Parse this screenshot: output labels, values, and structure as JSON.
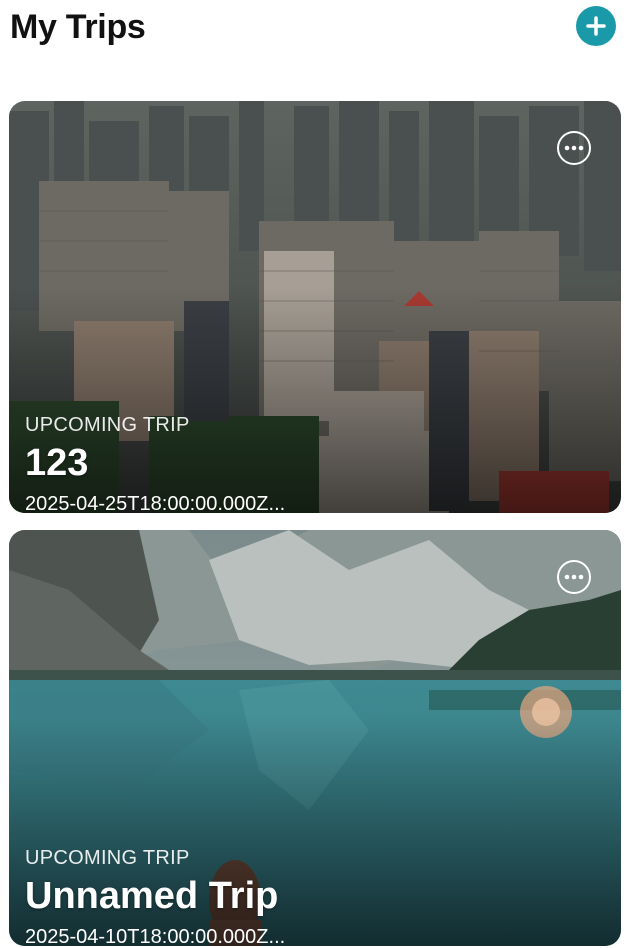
{
  "header": {
    "title": "My Trips",
    "add_icon": "plus-icon"
  },
  "colors": {
    "accent": "#1a9aa8",
    "title": "#111111",
    "card_text": "#ffffff"
  },
  "trips": [
    {
      "status": "UPCOMING TRIP",
      "name": "123",
      "date": "2025-04-25T18:00:00.000Z...",
      "image": "city-skyline",
      "menu_icon": "more-horizontal-icon"
    },
    {
      "status": "UPCOMING TRIP",
      "name": "Unnamed Trip",
      "date": "2025-04-10T18:00:00.000Z...",
      "image": "mountain-lake",
      "menu_icon": "more-horizontal-icon"
    }
  ]
}
